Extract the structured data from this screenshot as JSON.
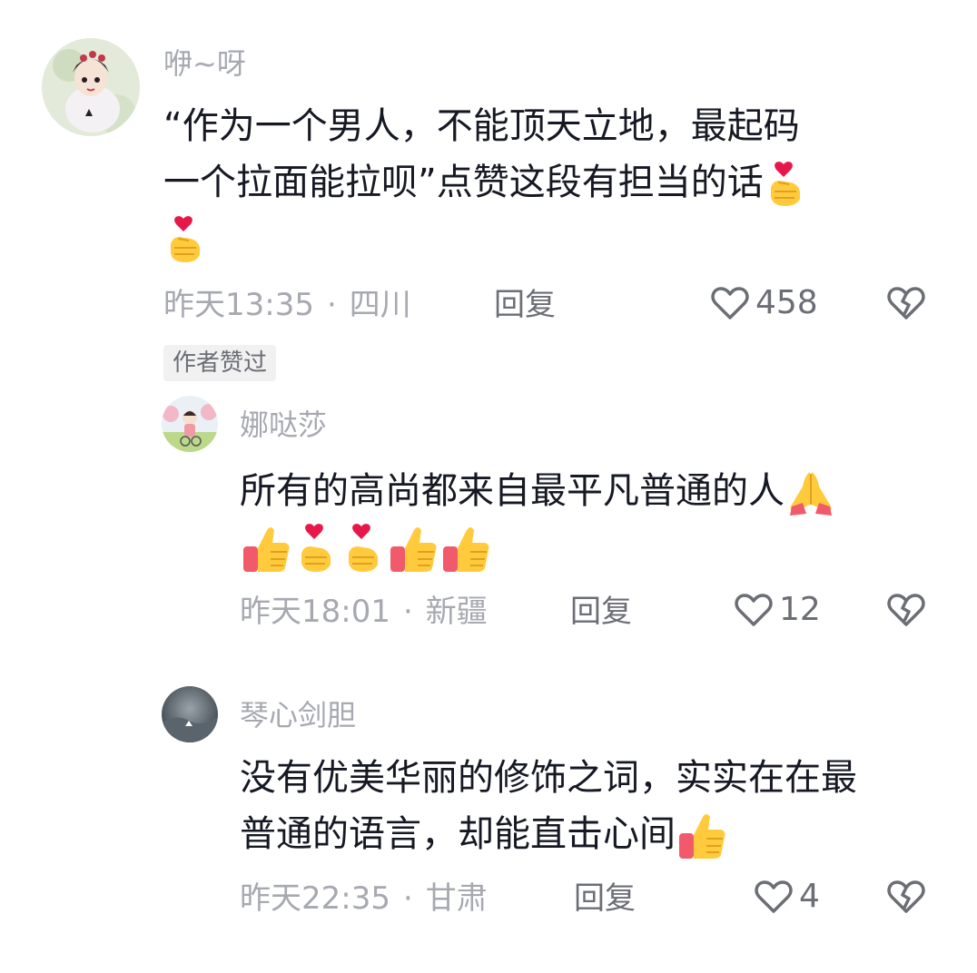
{
  "comments": [
    {
      "username": "咿~呀",
      "lines": [
        "“作为一个男人，不能顶天立地，最起码",
        "一个拉面能拉呗”点赞这段有担当的话"
      ],
      "emojis_inline": [
        "finger-heart-icon"
      ],
      "emojis_row": [
        "finger-heart-icon"
      ],
      "time": "昨天13:35",
      "separator": "·",
      "location": "四川",
      "reply_label": "回复",
      "likes": "458",
      "author_badge": "作者赞过"
    },
    {
      "username": "娜哒莎",
      "lines": [
        "所有的高尚都来自最平凡普通的人"
      ],
      "emojis_inline": [
        "folded-hands-icon"
      ],
      "emojis_row": [
        "thumbs-up-icon",
        "finger-heart-icon",
        "finger-heart-icon",
        "thumbs-up-icon",
        "thumbs-up-icon"
      ],
      "time": "昨天18:01",
      "separator": "·",
      "location": "新疆",
      "reply_label": "回复",
      "likes": "12"
    },
    {
      "username": "琴心剑胆",
      "lines": [
        "没有优美华丽的修饰之词，实实在在最",
        "普通的语言，却能直击心间"
      ],
      "emojis_inline": [
        "thumbs-up-icon"
      ],
      "time": "昨天22:35",
      "separator": "·",
      "location": "甘肃",
      "reply_label": "回复",
      "likes": "4"
    }
  ],
  "colors": {
    "text": "#161823",
    "muted": "#a7a9b0",
    "action": "#6c6e75",
    "badge_bg": "#f1f1f2"
  }
}
